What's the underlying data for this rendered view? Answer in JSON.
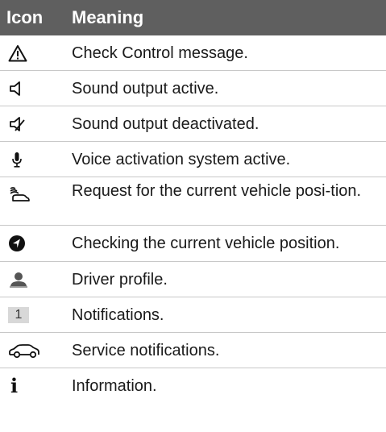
{
  "header": {
    "icon_col": "Icon",
    "meaning_col": "Meaning"
  },
  "rows": [
    {
      "icon": "warning-triangle-icon",
      "meaning": "Check Control message."
    },
    {
      "icon": "speaker-icon",
      "meaning": "Sound output active."
    },
    {
      "icon": "speaker-muted-icon",
      "meaning": "Sound output deactivated."
    },
    {
      "icon": "microphone-icon",
      "meaning": "Voice activation system active."
    },
    {
      "icon": "vehicle-position-request-icon",
      "meaning": "Request for the current vehicle posi-tion."
    },
    {
      "icon": "navigation-arrow-icon",
      "meaning": "Checking the current vehicle position."
    },
    {
      "icon": "driver-profile-icon",
      "meaning": "Driver profile."
    },
    {
      "icon": "notification-count-icon",
      "badge": "1",
      "meaning": "Notifications."
    },
    {
      "icon": "car-icon",
      "meaning": "Service notifications."
    },
    {
      "icon": "info-icon",
      "glyph": "i",
      "meaning": "Information."
    }
  ],
  "colors": {
    "header_bg": "#5f5f5f",
    "header_text": "#ffffff",
    "divider": "#c8c8c8"
  }
}
